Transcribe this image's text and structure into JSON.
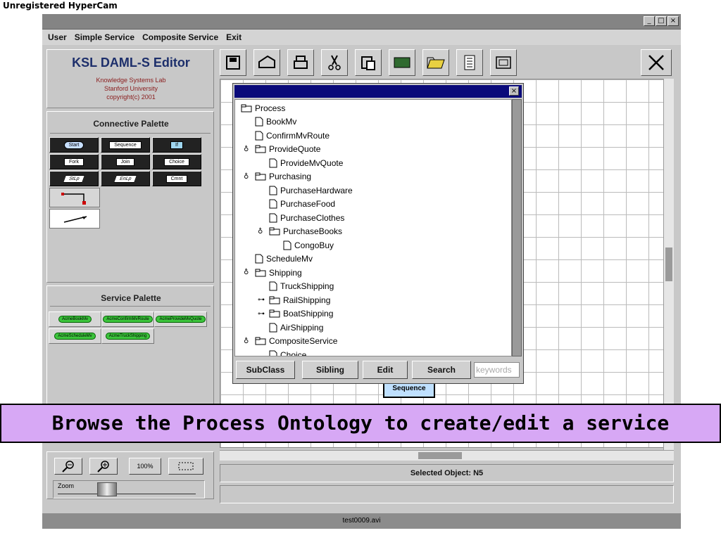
{
  "window": {
    "watermark": "Unregistered HyperCam",
    "buttons": [
      "_",
      "□",
      "×"
    ]
  },
  "menu": [
    "User",
    "Simple Service",
    "Composite Service",
    "Exit"
  ],
  "left_panel": {
    "app_name": "KSL DAML-S Editor",
    "org_lines": [
      "Knowledge Systems Lab",
      "Stanford University",
      "copyright(c) 2001"
    ],
    "connective_palette_title": "Connective Palette",
    "connective_items": [
      "Start",
      "Sequence",
      "If",
      "Fork",
      "Join",
      "Choice",
      "StLp",
      "EnLp",
      "Cmnt"
    ],
    "service_palette_title": "Service Palette",
    "service_items": [
      "AcmeBookMv",
      "AcmeConfirmMvRoute",
      "AcmeProvideMvQuote",
      "AcmeScheduleMv",
      "AcmeTruckShipping"
    ],
    "zoom_level": "100%",
    "zoom_label": "Zoom"
  },
  "dialog": {
    "tree": [
      {
        "label": "Process",
        "type": "folder",
        "depth": 0
      },
      {
        "label": "BookMv",
        "type": "leaf",
        "depth": 1
      },
      {
        "label": "ConfirmMvRoute",
        "type": "leaf",
        "depth": 1
      },
      {
        "label": "ProvideQuote",
        "type": "folder",
        "depth": 1,
        "handle": "open"
      },
      {
        "label": "ProvideMvQuote",
        "type": "leaf",
        "depth": 2
      },
      {
        "label": "Purchasing",
        "type": "folder",
        "depth": 1,
        "handle": "open"
      },
      {
        "label": "PurchaseHardware",
        "type": "leaf",
        "depth": 2
      },
      {
        "label": "PurchaseFood",
        "type": "leaf",
        "depth": 2
      },
      {
        "label": "PurchaseClothes",
        "type": "leaf",
        "depth": 2
      },
      {
        "label": "PurchaseBooks",
        "type": "folder",
        "depth": 2,
        "handle": "open"
      },
      {
        "label": "CongoBuy",
        "type": "leaf",
        "depth": 3
      },
      {
        "label": "ScheduleMv",
        "type": "leaf",
        "depth": 1
      },
      {
        "label": "Shipping",
        "type": "folder",
        "depth": 1,
        "handle": "open"
      },
      {
        "label": "TruckShipping",
        "type": "leaf",
        "depth": 2
      },
      {
        "label": "RailShipping",
        "type": "folder",
        "depth": 2,
        "handle": "closed"
      },
      {
        "label": "BoatShipping",
        "type": "folder",
        "depth": 2,
        "handle": "closed"
      },
      {
        "label": "AirShipping",
        "type": "leaf",
        "depth": 2
      },
      {
        "label": "CompositeService",
        "type": "folder",
        "depth": 1,
        "handle": "open"
      },
      {
        "label": "Choice",
        "type": "leaf",
        "depth": 2
      }
    ],
    "buttons": [
      "SubClass",
      "Sibling",
      "Edit",
      "Search"
    ],
    "search_placeholder": "keywords"
  },
  "canvas": {
    "sequence_node": "Sequence"
  },
  "status": {
    "selected": "Selected Object:  N5"
  },
  "bottom_filename": "test0009.avi",
  "banner": "Browse the Process Ontology to create/edit a service"
}
